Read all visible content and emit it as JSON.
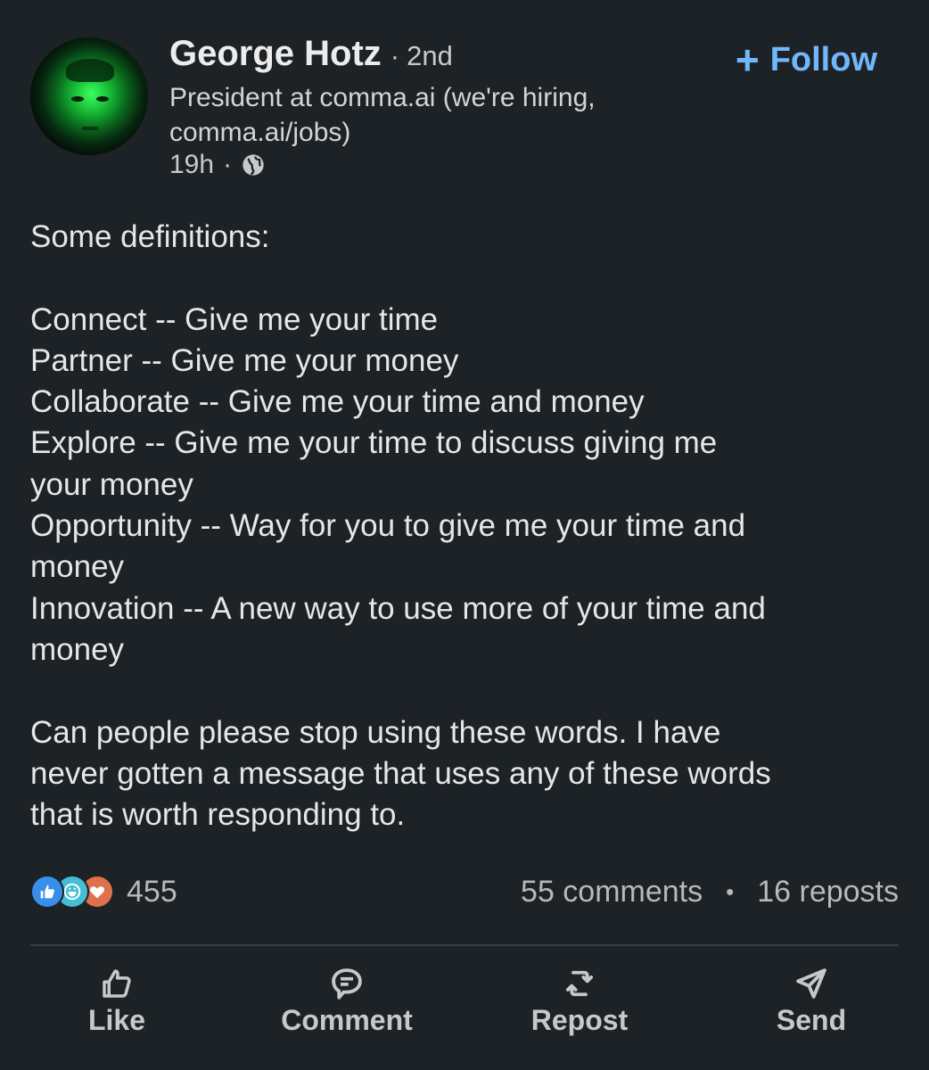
{
  "author": {
    "name": "George Hotz",
    "degree": "2nd",
    "headline": "President at comma.ai (we're hiring, comma.ai/jobs)",
    "time": "19h",
    "visibility_icon": "globe-icon"
  },
  "follow_button": {
    "icon": "plus-icon",
    "label": "Follow"
  },
  "post": {
    "lines": [
      "Some definitions:",
      "",
      "Connect -- Give me your time",
      "Partner -- Give me your money",
      "Collaborate -- Give me your time and money",
      "Explore -- Give me your time to discuss giving me",
      "your money",
      "Opportunity -- Way for you to give me your time and",
      "money",
      "Innovation -- A new way to use more of your time and",
      "money",
      "",
      "Can people please stop using these words. I have",
      "never gotten a message that uses any of these words",
      "that is worth responding to."
    ]
  },
  "stats": {
    "reaction_icons": [
      "like-reaction-icon",
      "funny-reaction-icon",
      "love-reaction-icon"
    ],
    "reactions": "455",
    "comments": "55 comments",
    "reposts": "16 reposts"
  },
  "actions": [
    {
      "icon": "thumbs-up-icon",
      "label": "Like"
    },
    {
      "icon": "comment-icon",
      "label": "Comment"
    },
    {
      "icon": "repost-icon",
      "label": "Repost"
    },
    {
      "icon": "send-icon",
      "label": "Send"
    }
  ],
  "colors": {
    "background": "#1d2226",
    "accent": "#71b7fb",
    "like_reaction": "#378fe9",
    "funny_reaction": "#44bfd3",
    "love_reaction": "#df704d"
  }
}
